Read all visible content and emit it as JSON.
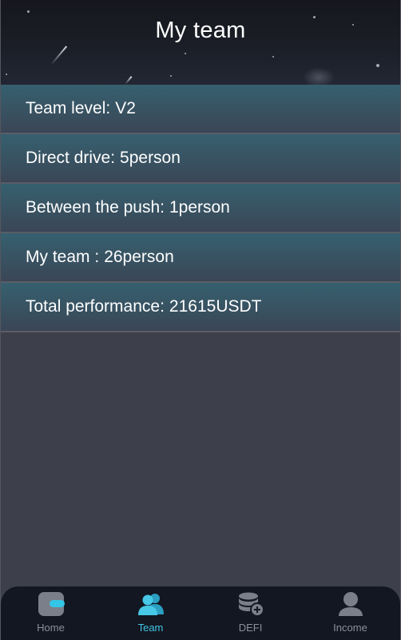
{
  "header": {
    "title": "My team"
  },
  "stats": [
    {
      "label": "Team level:",
      "value": "V2"
    },
    {
      "label": "Direct drive:",
      "value": "5person"
    },
    {
      "label": "Between the push:",
      "value": "1person"
    },
    {
      "label": "My team :",
      "value": "26person"
    },
    {
      "label": "Total performance:",
      "value": "21615USDT"
    }
  ],
  "tabbar": {
    "active": "Team",
    "tabs": [
      {
        "label": "Home",
        "icon": "wallet-icon"
      },
      {
        "label": "Team",
        "icon": "team-icon"
      },
      {
        "label": "DEFI",
        "icon": "coins-add-icon"
      },
      {
        "label": "Income",
        "icon": "user-icon"
      }
    ]
  },
  "colors": {
    "accent": "#3fc6e4",
    "tab_inactive": "#8b8f99",
    "row_top": "#36606f",
    "background": "#3d3f4a"
  }
}
